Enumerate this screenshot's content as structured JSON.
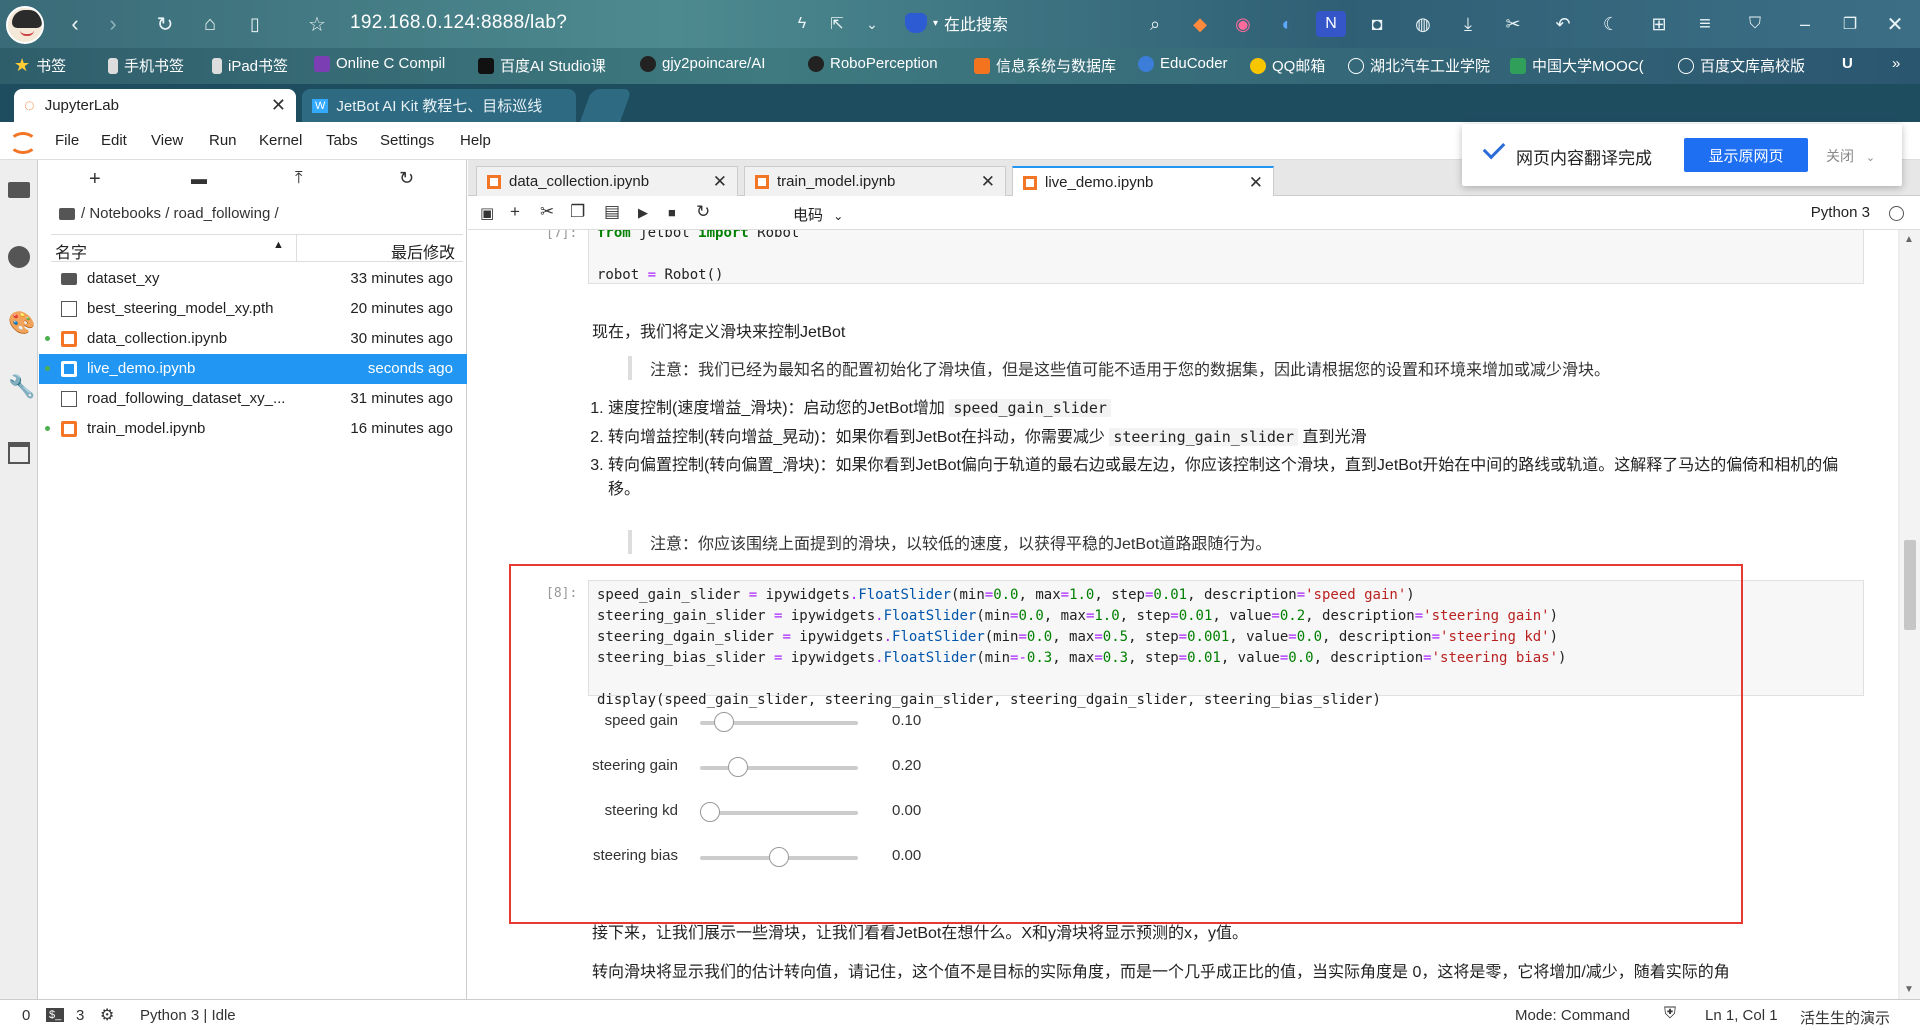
{
  "browser": {
    "url": "192.168.0.124:8888/lab?",
    "search_label": "在此搜索",
    "bookmarks": [
      "书签",
      "手机书签",
      "iPad书签",
      "Online C Compil",
      "百度AI Studio课",
      "gjy2poincare/AI",
      "RoboPerception",
      "信息系统与数据库",
      "EduCoder",
      "QQ邮箱",
      "湖北汽车工业学院",
      "中国大学MOOC(",
      "百度文库高校版"
    ],
    "tabs": [
      {
        "label": "JupyterLab"
      },
      {
        "label": "JetBot AI Kit 教程七、目标巡线"
      }
    ]
  },
  "menu": [
    "File",
    "Edit",
    "View",
    "Run",
    "Kernel",
    "Tabs",
    "Settings",
    "Help"
  ],
  "filebrowser": {
    "breadcrumb": "/ Notebooks / road_following /",
    "col_name": "名字",
    "col_modified": "最后修改",
    "files": [
      {
        "name": "dataset_xy",
        "time": "33 minutes ago",
        "type": "folder",
        "running": false,
        "selected": false
      },
      {
        "name": "best_steering_model_xy.pth",
        "time": "20 minutes ago",
        "type": "file",
        "running": false,
        "selected": false
      },
      {
        "name": "data_collection.ipynb",
        "time": "30 minutes ago",
        "type": "notebook",
        "running": true,
        "selected": false
      },
      {
        "name": "live_demo.ipynb",
        "time": "seconds ago",
        "type": "notebook",
        "running": true,
        "selected": true
      },
      {
        "name": "road_following_dataset_xy_...",
        "time": "31 minutes ago",
        "type": "file",
        "running": false,
        "selected": false
      },
      {
        "name": "train_model.ipynb",
        "time": "16 minutes ago",
        "type": "notebook",
        "running": true,
        "selected": false
      }
    ]
  },
  "doc_tabs": [
    {
      "label": "data_collection.ipynb"
    },
    {
      "label": "train_model.ipynb"
    },
    {
      "label": "live_demo.ipynb"
    }
  ],
  "toolbar": {
    "cell_type": "电码",
    "kernel": "Python 3"
  },
  "translate_popup": {
    "message": "网页内容翻译完成",
    "button": "显示原网页",
    "close": "关闭"
  },
  "notebook": {
    "cell7_prompt": "[7]:",
    "md_intro": "现在，我们将定义滑块来控制JetBot",
    "note1": "注意：我们已经为最知名的配置初始化了滑块值，但是这些值可能不适用于您的数据集，因此请根据您的设置和环境来增加或减少滑块。",
    "list_item1_text": "速度控制(速度增益_滑块)：启动您的JetBot增加",
    "list_item1_code": "speed_gain_slider",
    "list_item2_text": "转向增益控制(转向增益_晃动)：如果你看到JetBot在抖动，你需要减少",
    "list_item2_code": "steering_gain_slider",
    "list_item2_tail": "直到光滑",
    "list_item3_text": "转向偏置控制(转向偏置_滑块)：如果你看到JetBot偏向于轨道的最右边或最左边，你应该控制这个滑块，直到JetBot开始在中间的路线或轨道。这解释了马达的偏倚和相机的偏移。",
    "note2": "注意：你应该围绕上面提到的滑块，以较低的速度，以获得平稳的JetBot道路跟随行为。",
    "cell8_prompt": "[8]:",
    "md_after": "接下来，让我们展示一些滑块，让我们看看JetBot在想什么。X和y滑块将显示预测的x，y值。",
    "md_cut": "转向滑块将显示我们的估计转向值，请记住，这个值不是目标的实际角度，而是一个几乎成正比的值，当实际角度是 0，这将是零，它将增加/减少，随着实际的角"
  },
  "sliders": [
    {
      "label": "speed gain",
      "value": "0.10",
      "fraction": 0.1
    },
    {
      "label": "steering gain",
      "value": "0.20",
      "fraction": 0.2
    },
    {
      "label": "steering kd",
      "value": "0.00",
      "fraction": 0.0
    },
    {
      "label": "steering bias",
      "value": "0.00",
      "fraction": 0.5
    }
  ],
  "statusbar": {
    "count0": "0",
    "count1": "3",
    "kernel_status": "Python 3 | Idle",
    "mode": "Mode: Command",
    "position": "Ln 1, Col 1",
    "extra": "活生生的演示"
  },
  "colors": {
    "accent": "#2196f3",
    "jupyter_orange": "#f37626",
    "highlight_box": "#e53935"
  }
}
